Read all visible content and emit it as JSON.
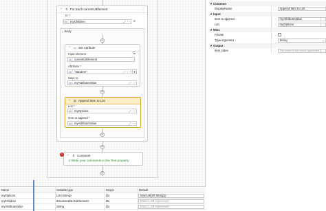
{
  "designer": {
    "for_each": {
      "title": "For Each currentUiElement",
      "in_label": "In",
      "in_required": "*",
      "in_value": "myChildren"
    },
    "body": {
      "label": "Body"
    },
    "set_attribute": {
      "title": "Set Attribute",
      "input_element_label": "Input element",
      "input_element_value": "currentUiElement",
      "attribute_label": "Attribute",
      "attribute_required": "*",
      "attribute_value": "\"aaname\"",
      "save_to_label": "Save to",
      "save_to_value": "myAttributeValue"
    },
    "append_item": {
      "title": "Append Item to List",
      "list_label": "List",
      "list_required": "*",
      "list_value": "myOptions",
      "item_label": "Item to append",
      "item_required": "*",
      "item_value": "myAttributeValue"
    },
    "comment": {
      "title": "Comment",
      "text": "// Write your comments in the Text property"
    }
  },
  "properties": {
    "sections": {
      "common": "Common",
      "input": "Input",
      "misc": "Misc",
      "output": "Output"
    },
    "rows": {
      "display_name": {
        "label": "DisplayName",
        "value": "Append Item to List"
      },
      "item_to_append": {
        "label": "Item to append",
        "value": "myAttributeValue"
      },
      "list": {
        "label": "List",
        "value": "myOptions"
      },
      "private": {
        "label": "Private",
        "checked": false
      },
      "type_argument": {
        "label": "TypeArgument",
        "value": "String"
      },
      "item_index": {
        "label": "Item index",
        "placeholder": "The index of the newly appended item"
      }
    }
  },
  "variables": {
    "headers": [
      "Name",
      "Variable type",
      "Scope",
      "Default"
    ],
    "rows": [
      {
        "name": "myOptions",
        "type": "List<String>",
        "scope": "Do",
        "default": "new List(Of String)()",
        "is_placeholder": false
      },
      {
        "name": "myChildren",
        "type": "IEnumerable<UiElement>",
        "scope": "Do",
        "default": "Enter a VB expression",
        "is_placeholder": true
      },
      {
        "name": "myAttributeValue",
        "type": "String",
        "scope": "Do",
        "default": "Enter a VB expression",
        "is_placeholder": true
      }
    ]
  },
  "colors": {
    "selected_border": "#d9a432",
    "selected_header": "#fbecc6",
    "comment_text": "#2e8b2e",
    "placeholder": "#9a9a9a",
    "required": "#c00000"
  }
}
